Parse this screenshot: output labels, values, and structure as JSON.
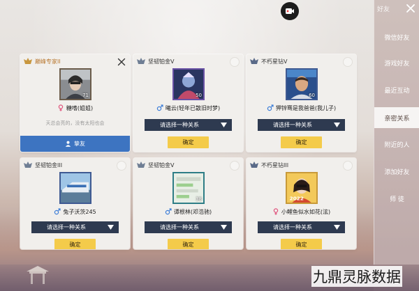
{
  "colors": {
    "confirm_button": "#f4cb4a",
    "dropdown_bg": "#2e3a50",
    "close_friend_button": "#3d74c1",
    "male_icon": "#3b7dd8",
    "female_icon": "#e0507a"
  },
  "sidebar": {
    "title": "好友",
    "items": [
      {
        "label": "微信好友"
      },
      {
        "label": "游戏好友"
      },
      {
        "label": "最近互动"
      },
      {
        "label": "亲密关系"
      },
      {
        "label": "附近的人"
      },
      {
        "label": "添加好友"
      },
      {
        "label": "师 徒"
      }
    ]
  },
  "relation_placeholder": "请选择一种关系",
  "confirm_label": "确定",
  "cards": [
    {
      "rank": "巅峰专家II",
      "level": "71",
      "name": "糖嗜(姐姐)",
      "gender": "female",
      "bio": "天总会亮的，没有太阳也会",
      "close_friend_label": "挚友"
    },
    {
      "rank": "坚韧铂金V",
      "level": "50",
      "name": "曦云(轻年已散旧时梦)",
      "gender": "male"
    },
    {
      "rank": "不朽星钻V",
      "level": "60",
      "name": "狎锌骞是我爸爸(我儿子)",
      "gender": "male"
    },
    {
      "rank": "坚韧铂金III",
      "level": "",
      "name": "兔子沃茨245",
      "gender": "male"
    },
    {
      "rank": "坚韧铂金V",
      "level": "38",
      "name": "谭根林(邓浩驰)",
      "gender": "male"
    },
    {
      "rank": "不朽星钻III",
      "level": "",
      "name": "小鲤鱼似水如花(泫)",
      "gender": "female"
    }
  ],
  "avatar_badge_text": "2022",
  "watermark": "九鼎灵脉数据"
}
